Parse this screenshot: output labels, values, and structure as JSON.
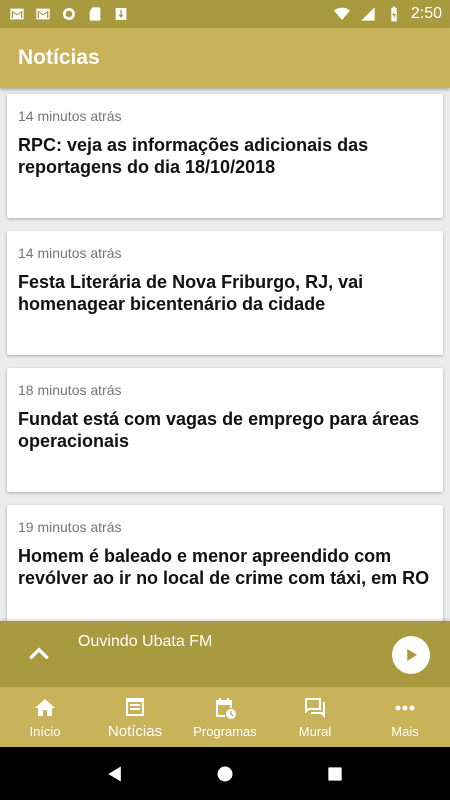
{
  "status_bar": {
    "time": "2:50",
    "icons": [
      "gmail-icon",
      "gmail-icon",
      "record-icon",
      "sd-card-icon",
      "download-icon",
      "wifi-icon",
      "signal-icon",
      "battery-charging-icon"
    ]
  },
  "app_bar": {
    "title": "Notícias"
  },
  "news": [
    {
      "time": "14 minutos atrás",
      "title": "RPC: veja as informações adicionais das reportagens do dia 18/10/2018"
    },
    {
      "time": "14 minutos atrás",
      "title": "Festa Literária de Nova Friburgo, RJ, vai homenagear bicentenário da cidade"
    },
    {
      "time": "18 minutos atrás",
      "title": "Fundat está com vagas de emprego para áreas operacionais"
    },
    {
      "time": "19 minutos atrás",
      "title": "Homem é baleado e menor apreendido com revólver ao ir no local de crime com táxi, em RO"
    }
  ],
  "player": {
    "label": "Ouvindo Ubata FM"
  },
  "bottom_nav": [
    {
      "label": "Início",
      "icon": "home-icon"
    },
    {
      "label": "Notícias",
      "icon": "news-icon"
    },
    {
      "label": "Programas",
      "icon": "calendar-clock-icon"
    },
    {
      "label": "Mural",
      "icon": "chat-icon"
    },
    {
      "label": "Mais",
      "icon": "more-icon"
    }
  ],
  "colors": {
    "primary": "#c8b35a",
    "primary_dark": "#a99a3f",
    "background": "#ececec"
  }
}
